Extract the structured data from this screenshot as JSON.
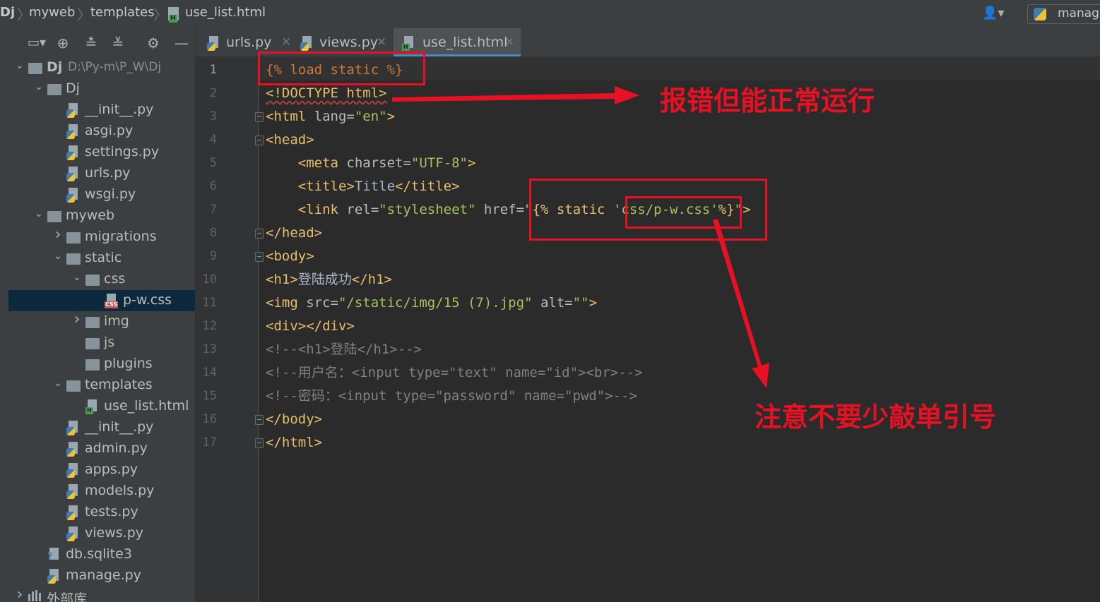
{
  "breadcrumb": {
    "root": "Dj",
    "items": [
      "myweb",
      "templates"
    ],
    "file": "use_list.html"
  },
  "topright": {
    "run_config": "manag"
  },
  "sidebar": {
    "tree": [
      {
        "indent": 0,
        "arrow": "down",
        "icon": "folder",
        "label": "Dj",
        "extra": "D:\\Py-m\\P_W\\Dj",
        "bold": true
      },
      {
        "indent": 1,
        "arrow": "down",
        "icon": "folder",
        "label": "Dj"
      },
      {
        "indent": 2,
        "arrow": "",
        "icon": "py",
        "label": "__init__.py"
      },
      {
        "indent": 2,
        "arrow": "",
        "icon": "py",
        "label": "asgi.py"
      },
      {
        "indent": 2,
        "arrow": "",
        "icon": "py",
        "label": "settings.py"
      },
      {
        "indent": 2,
        "arrow": "",
        "icon": "py",
        "label": "urls.py"
      },
      {
        "indent": 2,
        "arrow": "",
        "icon": "py",
        "label": "wsgi.py"
      },
      {
        "indent": 1,
        "arrow": "down",
        "icon": "folder",
        "label": "myweb"
      },
      {
        "indent": 2,
        "arrow": "right",
        "icon": "folder",
        "label": "migrations"
      },
      {
        "indent": 2,
        "arrow": "down",
        "icon": "folder",
        "label": "static"
      },
      {
        "indent": 3,
        "arrow": "down",
        "icon": "folder",
        "label": "css"
      },
      {
        "indent": 4,
        "arrow": "",
        "icon": "css",
        "label": "p-w.css",
        "selected": true
      },
      {
        "indent": 3,
        "arrow": "right",
        "icon": "folder",
        "label": "img"
      },
      {
        "indent": 3,
        "arrow": "",
        "icon": "folder",
        "label": "js"
      },
      {
        "indent": 3,
        "arrow": "",
        "icon": "folder",
        "label": "plugins"
      },
      {
        "indent": 2,
        "arrow": "down",
        "icon": "folder",
        "label": "templates"
      },
      {
        "indent": 3,
        "arrow": "",
        "icon": "html",
        "label": "use_list.html"
      },
      {
        "indent": 2,
        "arrow": "",
        "icon": "py",
        "label": "__init__.py"
      },
      {
        "indent": 2,
        "arrow": "",
        "icon": "py",
        "label": "admin.py"
      },
      {
        "indent": 2,
        "arrow": "",
        "icon": "py",
        "label": "apps.py"
      },
      {
        "indent": 2,
        "arrow": "",
        "icon": "py",
        "label": "models.py"
      },
      {
        "indent": 2,
        "arrow": "",
        "icon": "py",
        "label": "tests.py"
      },
      {
        "indent": 2,
        "arrow": "",
        "icon": "py",
        "label": "views.py"
      },
      {
        "indent": 1,
        "arrow": "",
        "icon": "db",
        "label": "db.sqlite3"
      },
      {
        "indent": 1,
        "arrow": "",
        "icon": "py",
        "label": "manage.py"
      },
      {
        "indent": 0,
        "arrow": "right",
        "icon": "lib",
        "label": "外部库"
      }
    ]
  },
  "tabs": [
    {
      "label": "urls.py",
      "icon": "py",
      "active": false
    },
    {
      "label": "views.py",
      "icon": "py",
      "active": false
    },
    {
      "label": "use_list.html",
      "icon": "html",
      "active": true
    }
  ],
  "editor": {
    "current_line": 1,
    "line_numbers": [
      "1",
      "2",
      "3",
      "4",
      "5",
      "6",
      "7",
      "8",
      "9",
      "10",
      "11",
      "12",
      "13",
      "14",
      "15",
      "16",
      "17"
    ],
    "lines": {
      "l1": "{% load static %}",
      "l2": "<!DOCTYPE html>",
      "l3a": "<html ",
      "l3b": "lang=",
      "l3c": "\"en\"",
      "l3d": ">",
      "l4": "<head>",
      "l5a": "<meta ",
      "l5b": "charset=",
      "l5c": "\"UTF-8\"",
      "l5d": ">",
      "l6a": "<title>",
      "l6b": "Title",
      "l6c": "</title>",
      "l7a": "<link ",
      "l7b": "rel=",
      "l7c": "\"stylesheet\" ",
      "l7d": "href=",
      "l7e": "\"",
      "l7f": "{% static ",
      "l7g": "'css/p-w.css'",
      "l7h": "%}",
      "l7i": "\"",
      "l7j": ">",
      "l8": "</head>",
      "l9": "<body>",
      "l10a": "<h1>",
      "l10b": "登陆成功",
      "l10c": "</h1>",
      "l11a": "<img ",
      "l11b": "src=",
      "l11c": "\"/static/img/15 (7).jpg\" ",
      "l11d": "alt=",
      "l11e": "\"\"",
      "l11f": ">",
      "l12": "<div></div>",
      "l13": "<!--<h1>登陆</h1>-->",
      "l14": "<!--用户名：<input type=\"text\" name=\"id\"><br>-->",
      "l15": "<!--密码：<input type=\"password\" name=\"pwd\">-->",
      "l16": "</body>",
      "l17": "</html>"
    }
  },
  "annotations": {
    "note1": "报错但能正常运行",
    "note2": "注意不要少敲单引号",
    "color": "#e81123"
  }
}
